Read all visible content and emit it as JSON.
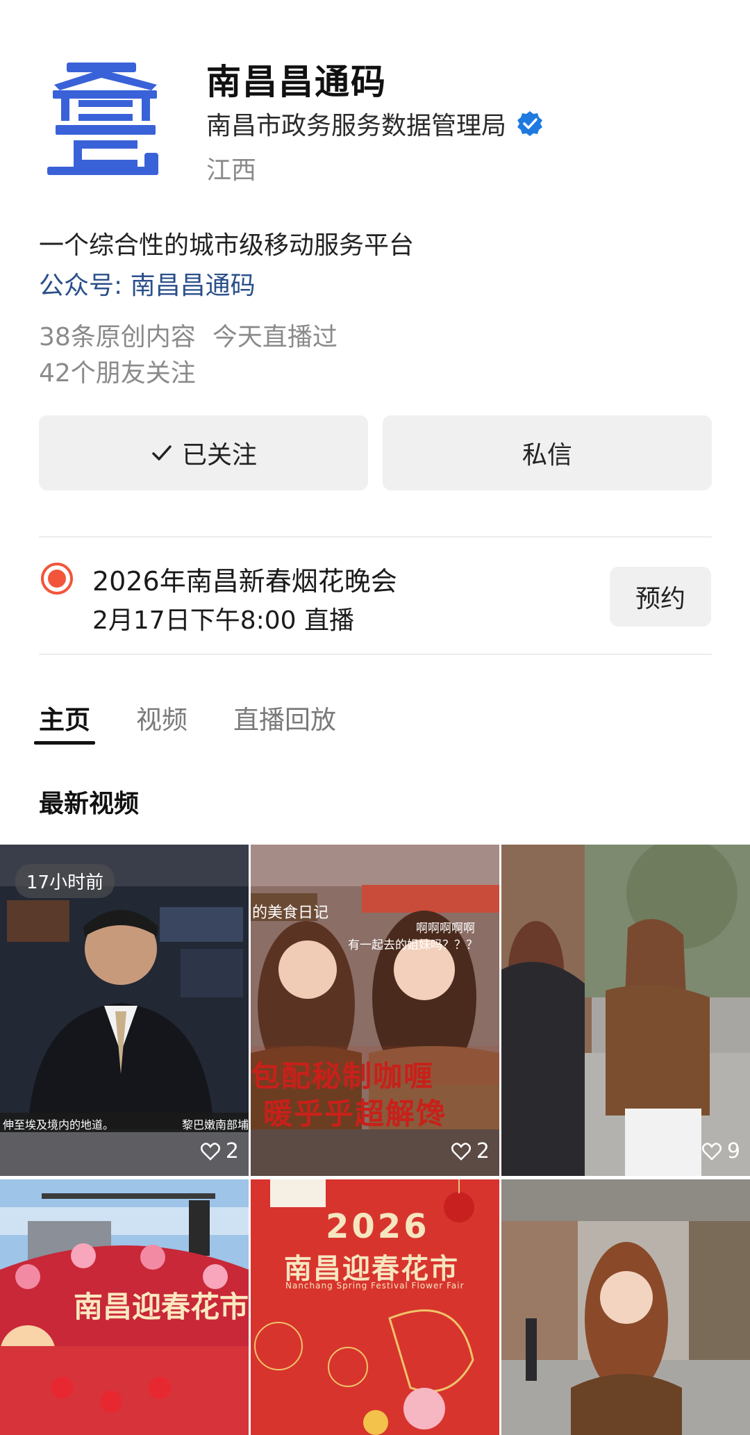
{
  "profile": {
    "name": "南昌昌通码",
    "org": "南昌市政务服务数据管理局",
    "region": "江西",
    "description": "一个综合性的城市级移动服务平台",
    "official_account": "公众号: 南昌昌通码",
    "original_count": "38条原创内容",
    "live_status": "今天直播过",
    "friends_following": "42个朋友关注"
  },
  "buttons": {
    "follow_label": "已关注",
    "message_label": "私信"
  },
  "live": {
    "title": "2026年南昌新春烟花晚会",
    "time": "2月17日下午8:00 直播",
    "reserve_label": "预约"
  },
  "tabs": [
    {
      "label": "主页"
    },
    {
      "label": "视频"
    },
    {
      "label": "直播回放"
    }
  ],
  "section": {
    "title": "最新视频"
  },
  "videos": [
    {
      "badge": "17小时前",
      "likes": "2",
      "caption": "伸至埃及境内的地道。",
      "caption2": "黎巴嫩南部埔"
    },
    {
      "likes": "2",
      "text1": "的美食日记",
      "text2": "啊啊啊啊啊",
      "text3": "有一起去的姐妹吗？？？",
      "text4": "包配秘制咖喱",
      "text5": "暖乎乎超解馋"
    },
    {
      "likes": "9"
    },
    {
      "text1": "南昌迎春花市"
    },
    {
      "text1": "2026",
      "text2": "南昌迎春花市",
      "text3": "Nanchang Spring Festival Flower Fair"
    },
    {}
  ],
  "colors": {
    "brand_blue": "#3a62d8",
    "verified_blue": "#1f7ae0",
    "live_red": "#f2553a",
    "link_blue": "#2a4f8a"
  }
}
